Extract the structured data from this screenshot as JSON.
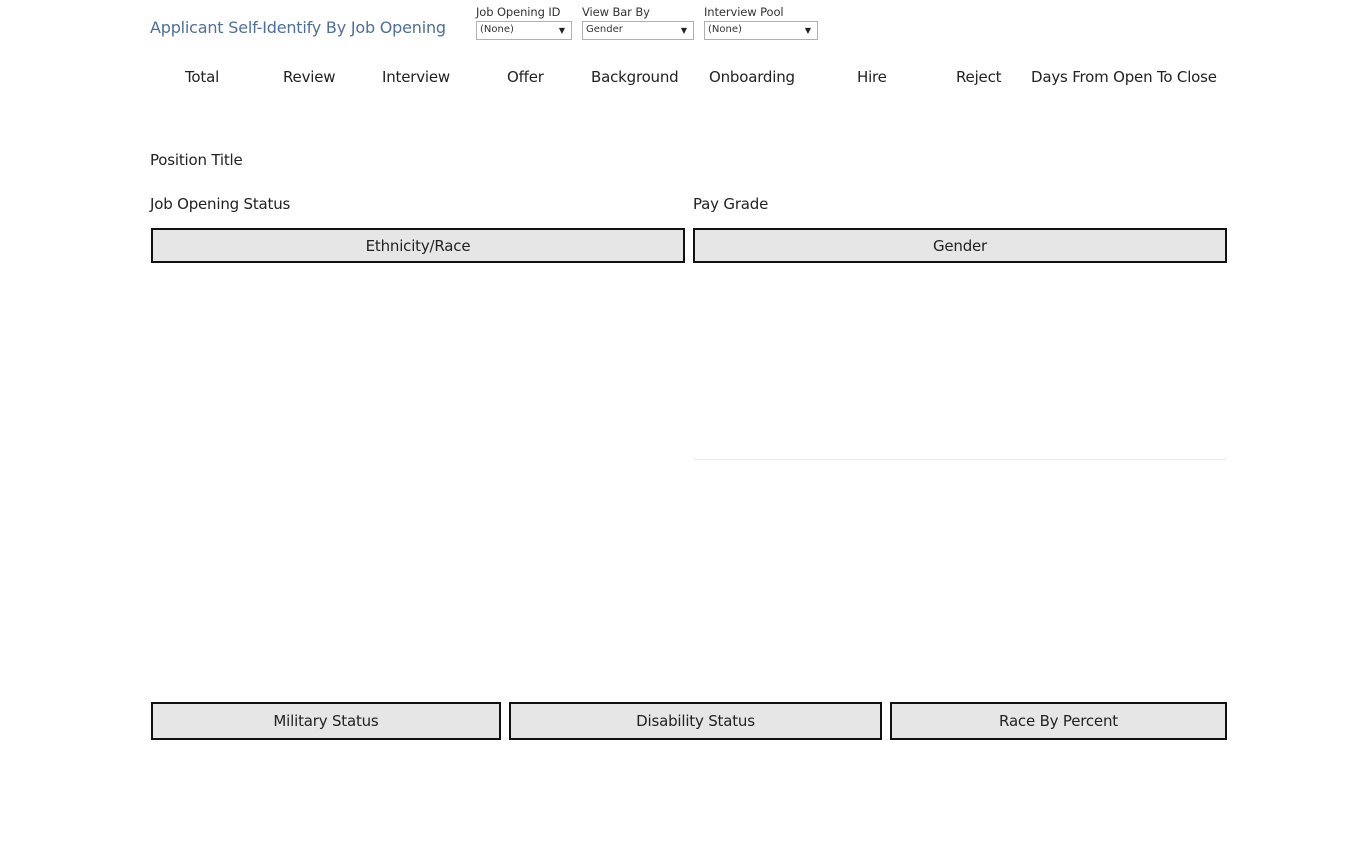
{
  "header": {
    "title": "Applicant Self-Identify By Job Opening"
  },
  "filters": [
    {
      "label": "Job Opening ID",
      "value": "(None)",
      "icon": "chevron-down-icon"
    },
    {
      "label": "View Bar By",
      "value": "Gender",
      "icon": "chevron-down-icon"
    },
    {
      "label": "Interview Pool",
      "value": "(None)",
      "icon": "chevron-down-icon"
    }
  ],
  "metrics": [
    "Total",
    "Review",
    "Interview",
    "Offer",
    "Background",
    "Onboarding",
    "Hire",
    "Reject",
    "Days From Open To Close"
  ],
  "fields": {
    "position_title": "Position Title",
    "job_opening_status": "Job Opening Status",
    "pay_grade": "Pay Grade"
  },
  "sections": {
    "ethnicity_race": "Ethnicity/Race",
    "gender": "Gender",
    "military_status": "Military Status",
    "disability_status": "Disability Status",
    "race_by_percent": "Race By Percent"
  },
  "colors": {
    "title": "#4e6f99",
    "section_bg": "#e6e6e6",
    "section_border": "#111111"
  }
}
